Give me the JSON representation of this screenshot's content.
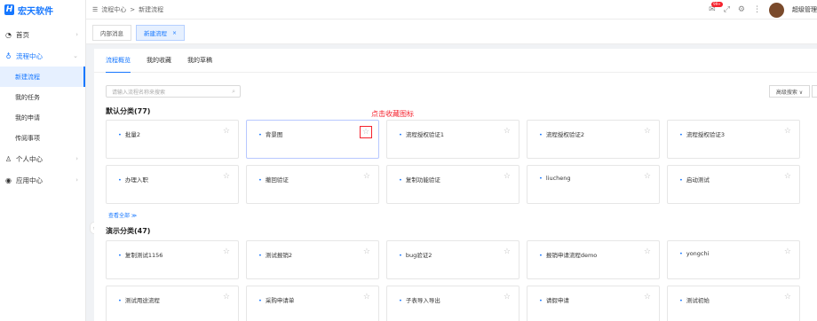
{
  "app": {
    "logo_mark": "H",
    "name": "宏天软件"
  },
  "sidebar": {
    "items": [
      {
        "label": "首页",
        "icon": "clock-icon"
      },
      {
        "label": "流程中心",
        "icon": "flow-icon"
      },
      {
        "label": "个人中心",
        "icon": "user-icon"
      },
      {
        "label": "应用中心",
        "icon": "app-icon"
      }
    ],
    "sub_items": [
      "新建流程",
      "我的任务",
      "我的申请",
      "传阅事项"
    ]
  },
  "topbar": {
    "breadcrumb": [
      "流程中心",
      "新建流程"
    ],
    "badge": "99+",
    "username": "超级管理员"
  },
  "tabs": [
    "内部消息",
    "新建流程"
  ],
  "subnav": [
    "流程概览",
    "我的收藏",
    "我的草稿"
  ],
  "search": {
    "placeholder": "请输入流程名称来搜索"
  },
  "advanced_search": "高级搜索 ∨",
  "annotation": "点击收藏图标",
  "show_all": "查看全部 ≫",
  "groups": [
    {
      "title": "默认分类(77)",
      "cards": [
        "批量2",
        "背景图",
        "流程授权验证1",
        "流程授权验证2",
        "流程授权验证3",
        "办理入职",
        "撤回验证",
        "复制功能验证",
        "liucheng",
        "启动测试"
      ]
    },
    {
      "title": "演示分类(47)",
      "cards": [
        "复制测试1156",
        "测试报销2",
        "bug验证2",
        "报销申请流程demo",
        "yongchi",
        "测试用途流程",
        "采购申请单",
        "子表导入导出",
        "请假申请",
        "测试初始"
      ]
    }
  ]
}
